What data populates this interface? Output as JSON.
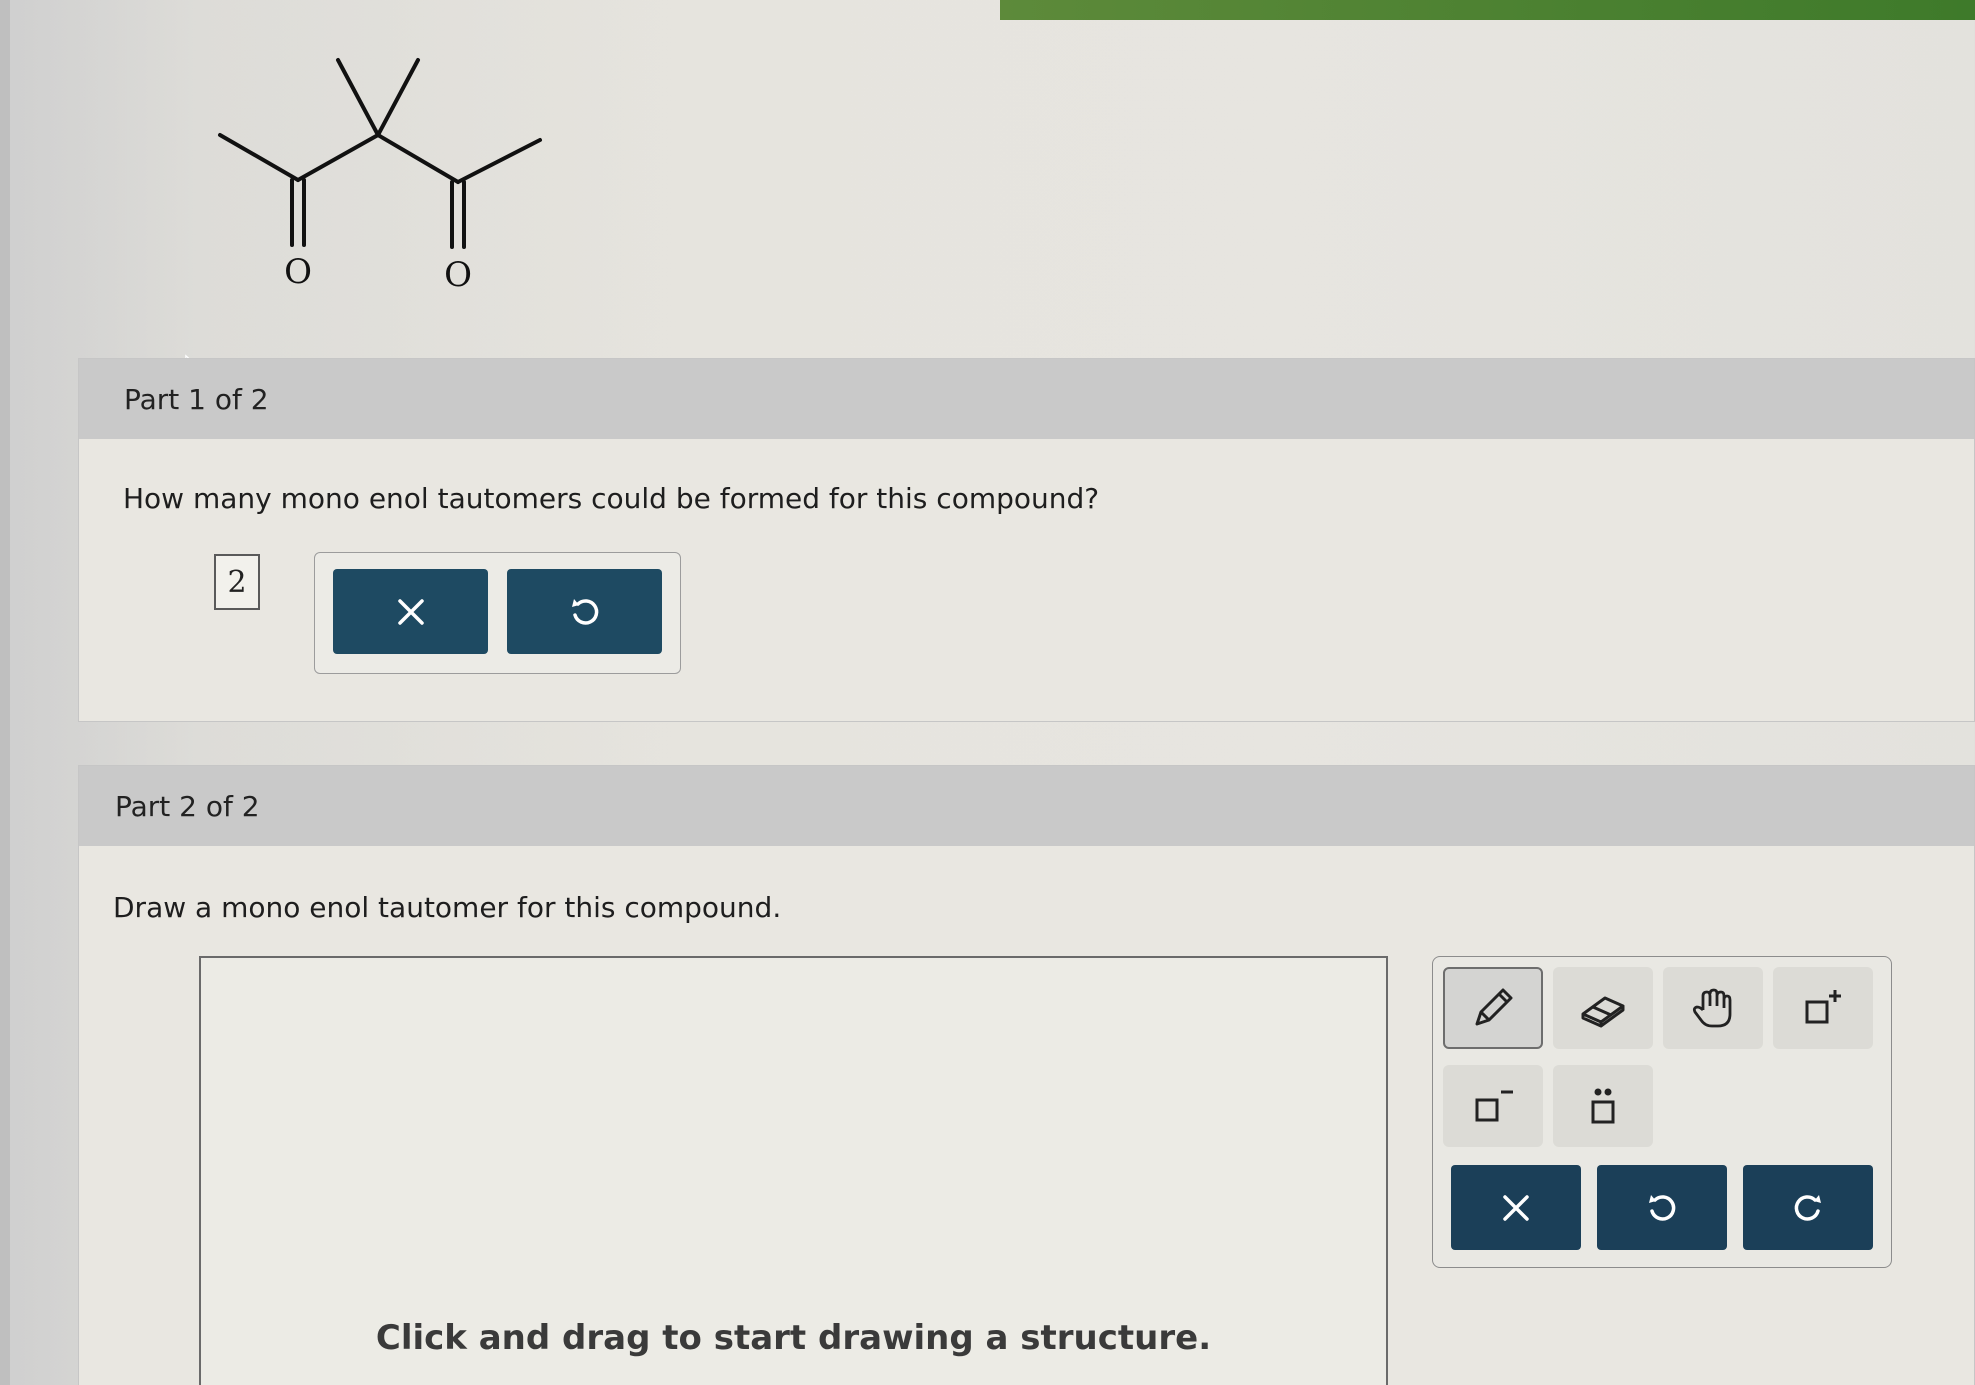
{
  "molecule": {
    "atom_labels": [
      "O",
      "O"
    ]
  },
  "part1": {
    "header": "Part 1 of 2",
    "question": "How many mono enol tautomers could be formed for this compound?",
    "answer_value": "2",
    "clear_button_icon": "close-icon",
    "undo_button_icon": "undo-icon"
  },
  "part2": {
    "header": "Part 2 of 2",
    "question": "Draw a mono enol tautomer for this compound.",
    "canvas_hint": "Click and drag to start drawing a structure.",
    "tools": [
      "pencil-icon",
      "eraser-icon",
      "hand-icon",
      "positive-charge-icon",
      "negative-charge-icon",
      "lone-pair-icon"
    ],
    "actions": [
      "close-icon",
      "undo-icon",
      "redo-icon"
    ]
  },
  "colors": {
    "button_primary": "#1e4a62",
    "header_bg": "#c9c9c9",
    "accent_top": "#3e7a2a"
  }
}
